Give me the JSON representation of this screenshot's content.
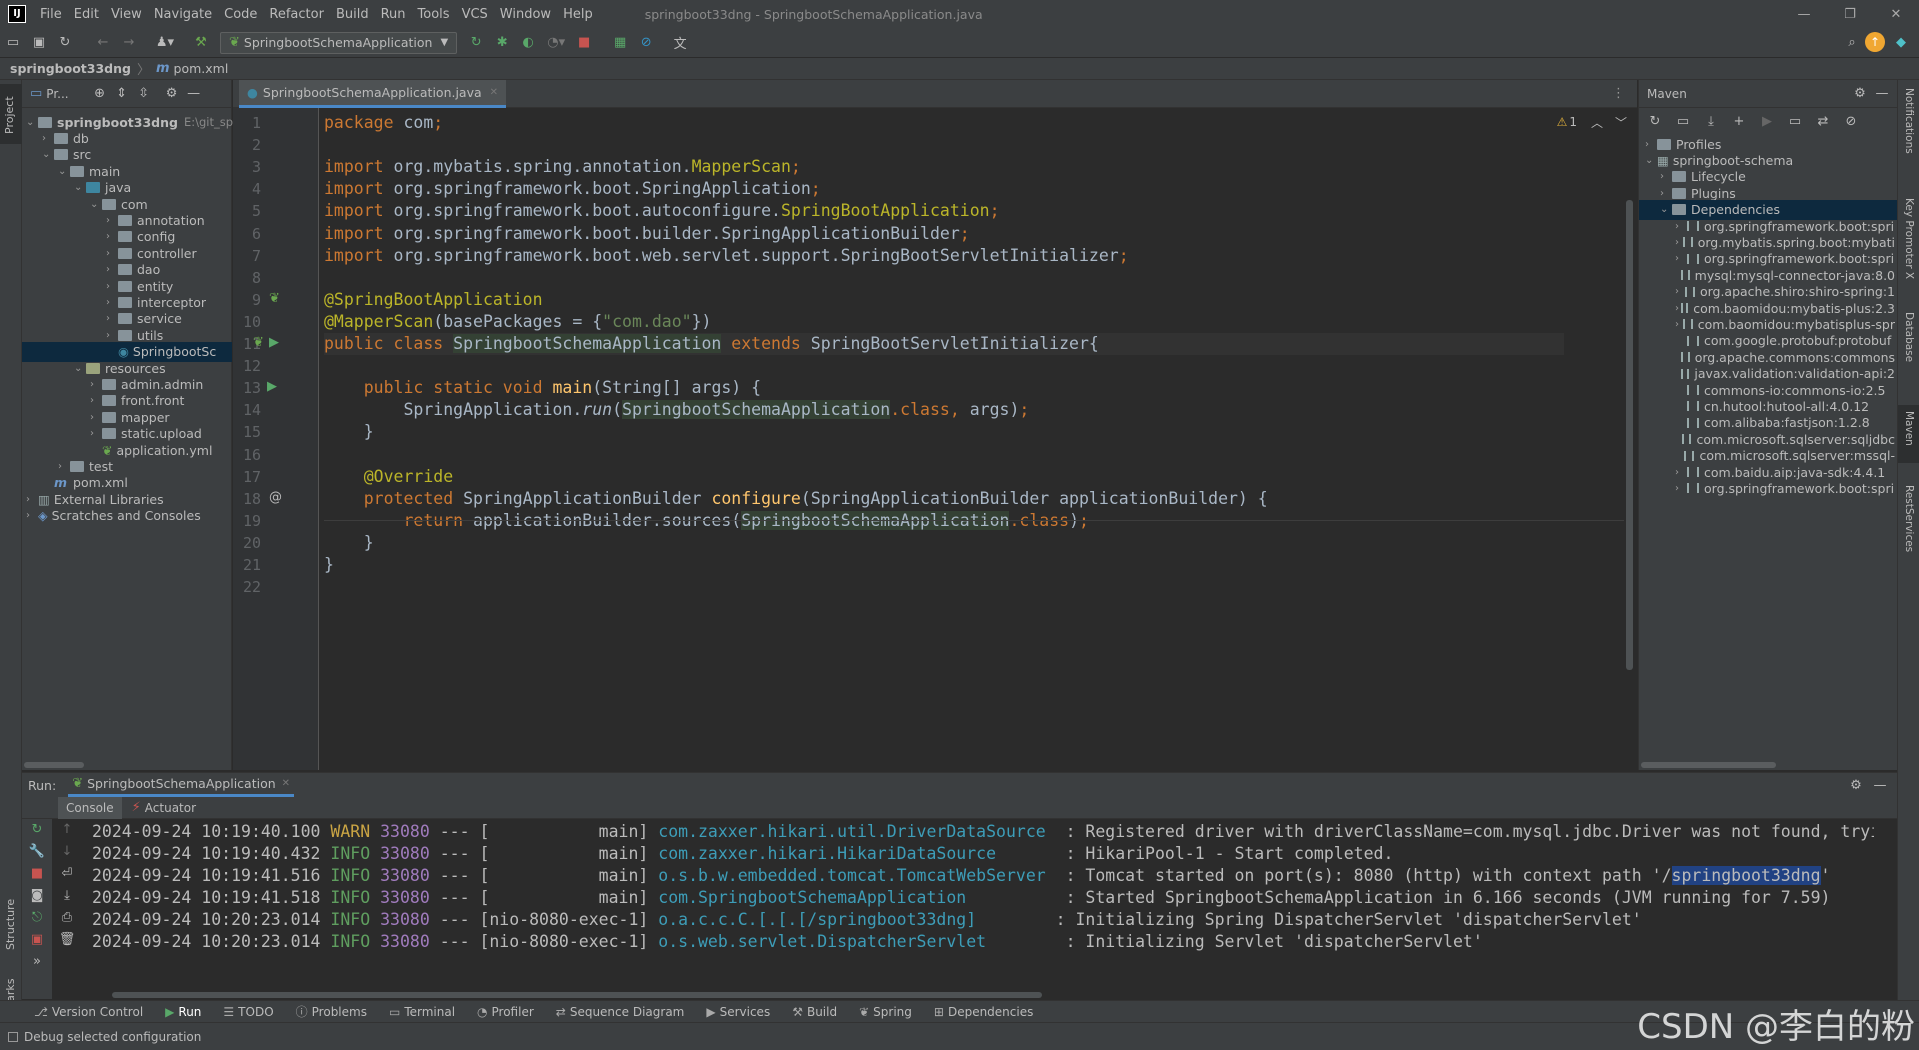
{
  "menu": [
    "File",
    "Edit",
    "View",
    "Navigate",
    "Code",
    "Refactor",
    "Build",
    "Run",
    "Tools",
    "VCS",
    "Window",
    "Help"
  ],
  "window_title": "springboot33dng - SpringbootSchemaApplication.java",
  "toolbar": {
    "run_config": "SpringbootSchemaApplication"
  },
  "breadcrumb": {
    "project": "springboot33dng",
    "file": "pom.xml"
  },
  "project_panel": {
    "title": "Pr...",
    "tree": [
      {
        "label": "springboot33dng",
        "extra": "E:\\git_spri",
        "level": 0,
        "type": "root",
        "open": true
      },
      {
        "label": "db",
        "level": 1,
        "type": "folder"
      },
      {
        "label": "src",
        "level": 1,
        "type": "folder",
        "open": true
      },
      {
        "label": "main",
        "level": 2,
        "type": "folder",
        "open": true
      },
      {
        "label": "java",
        "level": 3,
        "type": "folder-blue",
        "open": true
      },
      {
        "label": "com",
        "level": 4,
        "type": "folder",
        "open": true
      },
      {
        "label": "annotation",
        "level": 5,
        "type": "folder"
      },
      {
        "label": "config",
        "level": 5,
        "type": "folder"
      },
      {
        "label": "controller",
        "level": 5,
        "type": "folder"
      },
      {
        "label": "dao",
        "level": 5,
        "type": "folder"
      },
      {
        "label": "entity",
        "level": 5,
        "type": "folder"
      },
      {
        "label": "interceptor",
        "level": 5,
        "type": "folder"
      },
      {
        "label": "service",
        "level": 5,
        "type": "folder"
      },
      {
        "label": "utils",
        "level": 5,
        "type": "folder"
      },
      {
        "label": "SpringbootSc",
        "level": 5,
        "type": "class",
        "selected": true
      },
      {
        "label": "resources",
        "level": 3,
        "type": "folder-res",
        "open": true
      },
      {
        "label": "admin.admin",
        "level": 4,
        "type": "folder"
      },
      {
        "label": "front.front",
        "level": 4,
        "type": "folder"
      },
      {
        "label": "mapper",
        "level": 4,
        "type": "folder"
      },
      {
        "label": "static.upload",
        "level": 4,
        "type": "folder"
      },
      {
        "label": "application.yml",
        "level": 4,
        "type": "yml"
      },
      {
        "label": "test",
        "level": 2,
        "type": "folder"
      },
      {
        "label": "pom.xml",
        "level": 1,
        "type": "maven"
      },
      {
        "label": "External Libraries",
        "level": 0,
        "type": "lib"
      },
      {
        "label": "Scratches and Consoles",
        "level": 0,
        "type": "scratch"
      }
    ]
  },
  "editor": {
    "tab": "SpringbootSchemaApplication.java",
    "warnings": "1",
    "lines": [
      [
        [
          "kw",
          "package "
        ],
        [
          "cls",
          "com"
        ],
        [
          "kw",
          ";"
        ]
      ],
      [],
      [
        [
          "kw",
          "import "
        ],
        [
          "cls",
          "org.mybatis.spring.annotation."
        ],
        [
          "an",
          "MapperScan"
        ],
        [
          "kw",
          ";"
        ]
      ],
      [
        [
          "kw",
          "import "
        ],
        [
          "cls",
          "org.springframework.boot.SpringApplication"
        ],
        [
          "kw",
          ";"
        ]
      ],
      [
        [
          "kw",
          "import "
        ],
        [
          "cls",
          "org.springframework.boot.autoconfigure."
        ],
        [
          "an",
          "SpringBootApplication"
        ],
        [
          "kw",
          ";"
        ]
      ],
      [
        [
          "kw",
          "import "
        ],
        [
          "cls",
          "org.springframework.boot.builder.SpringApplicationBuilder"
        ],
        [
          "kw",
          ";"
        ]
      ],
      [
        [
          "kw",
          "import "
        ],
        [
          "cls",
          "org.springframework.boot.web.servlet.support.SpringBootServletInitializer"
        ],
        [
          "kw",
          ";"
        ]
      ],
      [],
      [
        [
          "an",
          "@SpringBootApplication"
        ]
      ],
      [
        [
          "an",
          "@MapperScan"
        ],
        [
          "cls",
          "(basePackages = {"
        ],
        [
          "str",
          "\"com.dao\""
        ],
        [
          "cls",
          "})"
        ]
      ],
      [
        [
          "kw",
          "public class "
        ],
        [
          "hl",
          "SpringbootSchemaApplication"
        ],
        [
          "kw",
          " extends "
        ],
        [
          "cls",
          "SpringBootServletInitializer{"
        ]
      ],
      [],
      [
        [
          "kw",
          "    public static void "
        ],
        [
          "fn",
          "main"
        ],
        [
          "cls",
          "(String[] args) {"
        ]
      ],
      [
        [
          "cls",
          "        SpringApplication."
        ],
        [
          "it",
          "run"
        ],
        [
          "cls",
          "("
        ],
        [
          "hl",
          "SpringbootSchemaApplication"
        ],
        [
          "kw",
          ".class"
        ],
        [
          "kw",
          ", "
        ],
        [
          "cls",
          "args)"
        ],
        [
          "kw",
          ";"
        ]
      ],
      [
        [
          "cls",
          "    }"
        ]
      ],
      [],
      [
        [
          "an",
          "    @Override"
        ]
      ],
      [
        [
          "kw",
          "    protected "
        ],
        [
          "cls",
          "SpringApplicationBuilder "
        ],
        [
          "fn",
          "configure"
        ],
        [
          "cls",
          "(SpringApplicationBuilder applicationBuilder) {"
        ]
      ],
      [
        [
          "kw",
          "        return "
        ],
        [
          "cls",
          "applicationBuilder.sources("
        ],
        [
          "hl",
          "SpringbootSchemaApplication"
        ],
        [
          "kw",
          ".class"
        ],
        [
          "cls",
          ")"
        ],
        [
          "kw",
          ";"
        ]
      ],
      [
        [
          "cls",
          "    }"
        ]
      ],
      [
        [
          "cls",
          "}"
        ]
      ],
      []
    ]
  },
  "maven": {
    "title": "Maven",
    "tree": [
      {
        "label": "Profiles",
        "level": 0,
        "type": "folder"
      },
      {
        "label": "springboot-schema",
        "level": 0,
        "type": "module",
        "open": true
      },
      {
        "label": "Lifecycle",
        "level": 1,
        "type": "folder"
      },
      {
        "label": "Plugins",
        "level": 1,
        "type": "folder"
      },
      {
        "label": "Dependencies",
        "level": 1,
        "type": "folder",
        "open": true,
        "selected": true
      },
      {
        "label": "org.springframework.boot:spri",
        "level": 2,
        "type": "dep",
        "exp": true
      },
      {
        "label": "org.mybatis.spring.boot:mybati",
        "level": 2,
        "type": "dep",
        "exp": true
      },
      {
        "label": "org.springframework.boot:spri",
        "level": 2,
        "type": "dep",
        "exp": true
      },
      {
        "label": "mysql:mysql-connector-java:8.0",
        "level": 2,
        "type": "dep"
      },
      {
        "label": "org.apache.shiro:shiro-spring:1",
        "level": 2,
        "type": "dep",
        "exp": true
      },
      {
        "label": "com.baomidou:mybatis-plus:2.3",
        "level": 2,
        "type": "dep",
        "exp": true
      },
      {
        "label": "com.baomidou:mybatisplus-spr",
        "level": 2,
        "type": "dep",
        "exp": true
      },
      {
        "label": "com.google.protobuf:protobuf",
        "level": 2,
        "type": "dep"
      },
      {
        "label": "org.apache.commons:commons",
        "level": 2,
        "type": "dep"
      },
      {
        "label": "javax.validation:validation-api:2",
        "level": 2,
        "type": "dep"
      },
      {
        "label": "commons-io:commons-io:2.5",
        "level": 2,
        "type": "dep"
      },
      {
        "label": "cn.hutool:hutool-all:4.0.12",
        "level": 2,
        "type": "dep"
      },
      {
        "label": "com.alibaba:fastjson:1.2.8",
        "level": 2,
        "type": "dep"
      },
      {
        "label": "com.microsoft.sqlserver:sqljdbc",
        "level": 2,
        "type": "dep"
      },
      {
        "label": "com.microsoft.sqlserver:mssql-",
        "level": 2,
        "type": "dep"
      },
      {
        "label": "com.baidu.aip:java-sdk:4.4.1",
        "level": 2,
        "type": "dep",
        "exp": true
      },
      {
        "label": "org.springframework.boot:spri",
        "level": 2,
        "type": "dep",
        "exp": true
      }
    ]
  },
  "run": {
    "label": "Run:",
    "config": "SpringbootSchemaApplication",
    "tabs": [
      "Console",
      "Actuator"
    ],
    "logs": [
      {
        "ts": "2024-09-24 10:19:40.100",
        "level": "WARN",
        "pid": "33080",
        "sep": " --- ",
        "thread": "[           main]",
        "logger": "com.zaxxer.hikari.util.DriverDataSource  ",
        "msg": ": Registered driver with driverClassName=com.mysql.jdbc.Driver was not found, tryi"
      },
      {
        "ts": "2024-09-24 10:19:40.432",
        "level": "INFO",
        "pid": "33080",
        "sep": " --- ",
        "thread": "[           main]",
        "logger": "com.zaxxer.hikari.HikariDataSource       ",
        "msg": ": HikariPool-1 - Start completed."
      },
      {
        "ts": "2024-09-24 10:19:41.516",
        "level": "INFO",
        "pid": "33080",
        "sep": " --- ",
        "thread": "[           main]",
        "logger": "o.s.b.w.embedded.tomcat.TomcatWebServer  ",
        "msg": ": Tomcat started on port(s): 8080 (http) with context path '/",
        "msg_hl": "springboot33dng",
        "msg_tail": "'"
      },
      {
        "ts": "2024-09-24 10:19:41.518",
        "level": "INFO",
        "pid": "33080",
        "sep": " --- ",
        "thread": "[           main]",
        "logger": "com.SpringbootSchemaApplication          ",
        "msg": ": Started SpringbootSchemaApplication in 6.166 seconds (JVM running for 7.59)"
      },
      {
        "ts": "2024-09-24 10:20:23.014",
        "level": "INFO",
        "pid": "33080",
        "sep": " --- ",
        "thread": "[nio-8080-exec-1]",
        "logger": "o.a.c.c.C.[.[.[/springboot33dng]        ",
        "msg": ": Initializing Spring DispatcherServlet 'dispatcherServlet'"
      },
      {
        "ts": "2024-09-24 10:20:23.014",
        "level": "INFO",
        "pid": "33080",
        "sep": " --- ",
        "thread": "[nio-8080-exec-1]",
        "logger": "o.s.web.servlet.DispatcherServlet        ",
        "msg": ": Initializing Servlet 'dispatcherServlet'"
      }
    ]
  },
  "bottom_tools": [
    "Version Control",
    "Run",
    "TODO",
    "Problems",
    "Terminal",
    "Profiler",
    "Sequence Diagram",
    "Services",
    "Build",
    "Spring",
    "Dependencies"
  ],
  "status": {
    "message": "Debug selected configuration",
    "watermark": "CSDN @李白的粉"
  },
  "left_strip": [
    "Project",
    "Structure",
    "Bookmarks"
  ],
  "right_strip": [
    "Notifications",
    "Key Promoter X",
    "Database",
    "Maven",
    "RestServices"
  ],
  "colors": {
    "keyword": "#cc7832",
    "annotation": "#bbb529",
    "string": "#6a8759",
    "logger": "#3d9db8",
    "info": "#5f9e5f",
    "warn": "#c9a444",
    "pid": "#a07bbd"
  }
}
